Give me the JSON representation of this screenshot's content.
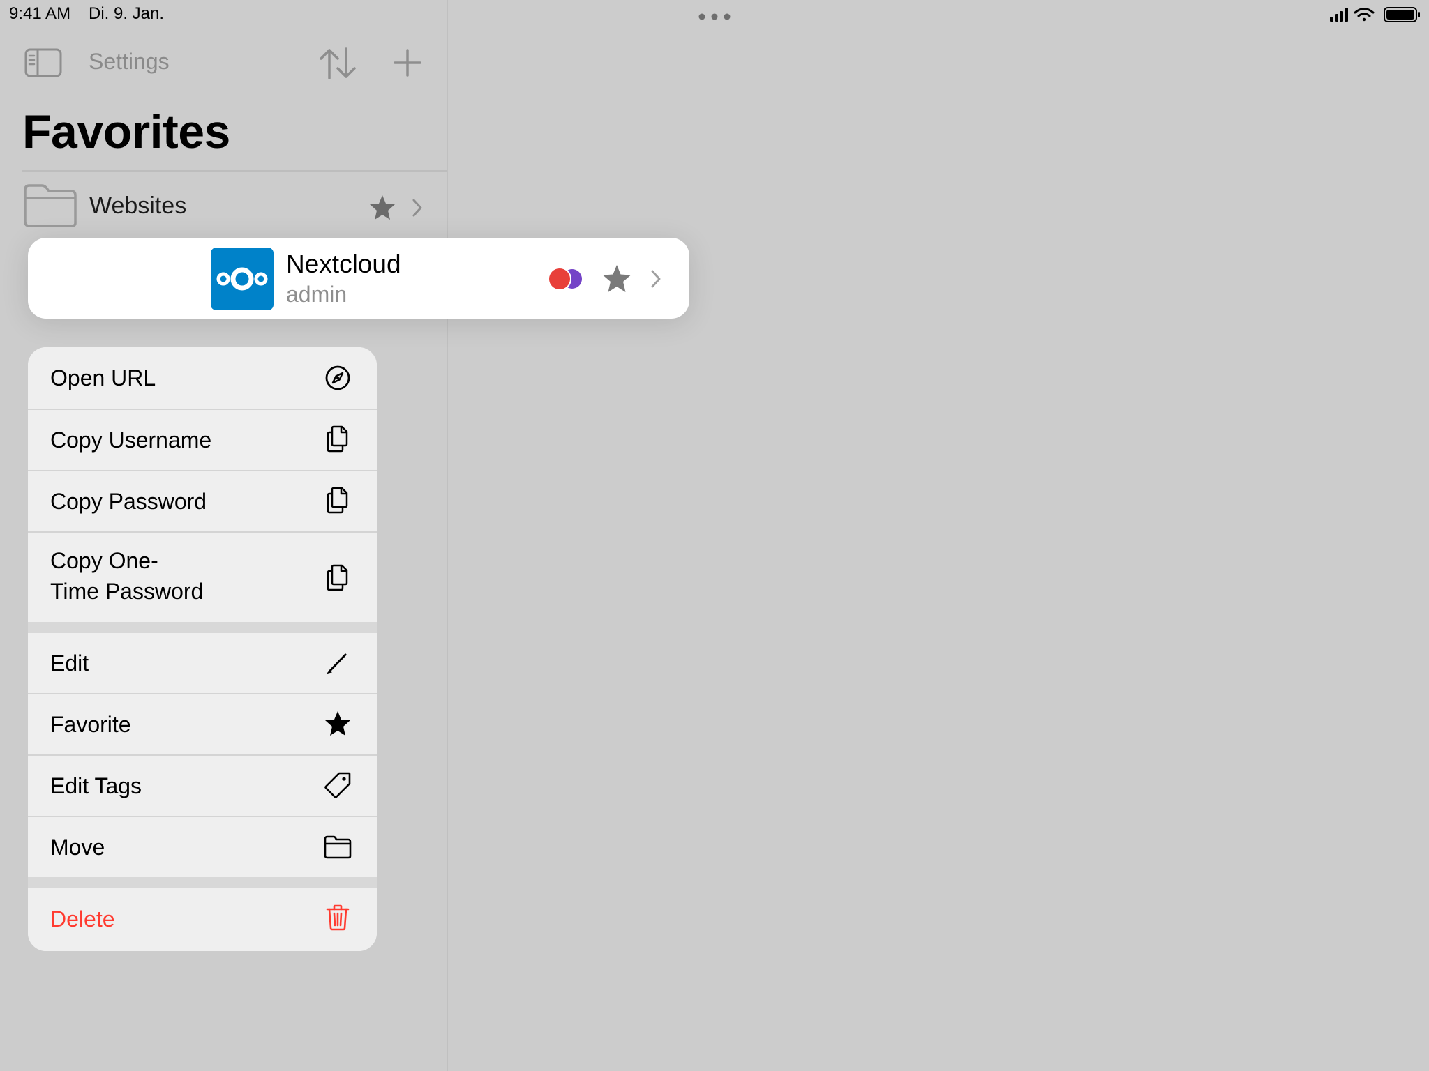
{
  "status_bar": {
    "time": "9:41 AM",
    "date": "Di. 9. Jan."
  },
  "sidebar": {
    "settings_label": "Settings",
    "title": "Favorites",
    "folder": {
      "label": "Websites"
    }
  },
  "entry": {
    "title": "Nextcloud",
    "subtitle": "admin",
    "icon": "nextcloud-logo",
    "tag_colors": [
      "#e8403a",
      "#7443c7"
    ]
  },
  "menu": {
    "open_url": "Open URL",
    "copy_username": "Copy Username",
    "copy_password": "Copy Password",
    "copy_otp_line1": "Copy One-",
    "copy_otp_line2": "Time Password",
    "edit": "Edit",
    "favorite": "Favorite",
    "edit_tags": "Edit Tags",
    "move": "Move",
    "delete": "Delete"
  },
  "colors": {
    "destructive": "#ff3b30",
    "nextcloud_blue": "#0082c9"
  }
}
